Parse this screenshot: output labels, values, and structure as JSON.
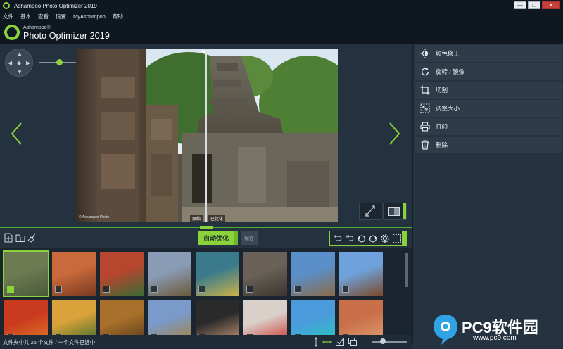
{
  "window": {
    "title": "Ashampoo Photo Optimizer 2019",
    "min": "—",
    "max": "□",
    "close": "✕"
  },
  "menu": [
    "文件",
    "基本",
    "查看",
    "设置",
    "MyAshampoo",
    "帮助"
  ],
  "brand": {
    "small": "Ashampoo®",
    "large": "Photo Optimizer 2019",
    "accent": "#8bd33a"
  },
  "viewer": {
    "zoom_minus": "−",
    "zoom_plus": "+",
    "zoom_level": 0.35,
    "split_handle": "◂▸",
    "before_label": "原始",
    "after_label": "已优化",
    "copyright": "© Ashampoo Photo"
  },
  "right_panel": {
    "items": [
      {
        "label": "颜色修正",
        "icon": "brightness-icon"
      },
      {
        "label": "旋转 / 镜像",
        "icon": "rotate-icon"
      },
      {
        "label": "切割",
        "icon": "crop-icon"
      },
      {
        "label": "调整大小",
        "icon": "resize-icon"
      },
      {
        "label": "打印",
        "icon": "print-icon"
      },
      {
        "label": "删除",
        "icon": "trash-icon"
      }
    ]
  },
  "toolbar": {
    "auto_label": "自动优化",
    "save_label": "保存"
  },
  "thumbnails": [
    {
      "selected": true,
      "colors": [
        "#6d7a52",
        "#4a5a3a"
      ]
    },
    {
      "selected": false,
      "colors": [
        "#c96a3a",
        "#7a3a22"
      ]
    },
    {
      "selected": false,
      "colors": [
        "#b8452e",
        "#3d6b35"
      ]
    },
    {
      "selected": false,
      "colors": [
        "#8a9bb5",
        "#6b5a3a"
      ]
    },
    {
      "selected": false,
      "colors": [
        "#3a7a8a",
        "#c9b24a"
      ]
    },
    {
      "selected": false,
      "colors": [
        "#6a6258",
        "#3a352f"
      ]
    },
    {
      "selected": false,
      "colors": [
        "#5a8fc9",
        "#8a6a4a"
      ]
    },
    {
      "selected": false,
      "colors": [
        "#6fa2dc",
        "#7a4a2a"
      ]
    },
    {
      "selected": false,
      "colors": [
        "#c93a1e",
        "#e07a2a"
      ]
    },
    {
      "selected": false,
      "colors": [
        "#d9a23a",
        "#3a6a2a"
      ]
    },
    {
      "selected": false,
      "colors": [
        "#a8702a",
        "#5a3a1a"
      ]
    },
    {
      "selected": false,
      "colors": [
        "#7a9ac9",
        "#a8803a"
      ]
    },
    {
      "selected": false,
      "colors": [
        "#2a2a2a",
        "#c99a7a"
      ]
    },
    {
      "selected": false,
      "colors": [
        "#d9d0c9",
        "#c9302a"
      ]
    },
    {
      "selected": false,
      "colors": [
        "#4a9adc",
        "#2ac9c0"
      ]
    },
    {
      "selected": false,
      "colors": [
        "#c9704a",
        "#e0a070"
      ]
    }
  ],
  "status": {
    "text": "文件夹中共 25 个文件 / 一个文件已选中",
    "thumb_size_level": 0.3
  },
  "watermark": {
    "text": "PC9软件园",
    "url": "www.pc9.com"
  }
}
